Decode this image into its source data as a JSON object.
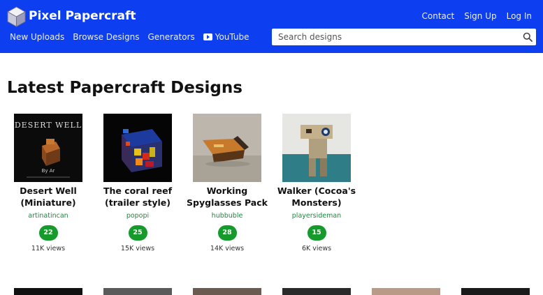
{
  "header": {
    "brand": "Pixel Papercraft",
    "auth_links": [
      "Contact",
      "Sign Up",
      "Log In"
    ],
    "nav": [
      "New Uploads",
      "Browse Designs",
      "Generators"
    ],
    "youtube_label": "YouTube",
    "search_placeholder": "Search designs",
    "bg_color": "#0d3ff0"
  },
  "main": {
    "title": "Latest Papercraft Designs",
    "cards": [
      {
        "title": "Desert Well (Miniature)",
        "author": "artinatincan",
        "likes": "22",
        "views": "11K views",
        "thumb_caption": "DESERT WELL",
        "thumb_byline": "By Ar"
      },
      {
        "title": "The coral reef (trailer style)",
        "author": "popopi",
        "likes": "25",
        "views": "15K views"
      },
      {
        "title": "Working Spyglasses Pack",
        "author": "hubbuble",
        "likes": "28",
        "views": "14K views"
      },
      {
        "title": "Walker (Cocoa's Monsters)",
        "author": "playersideman",
        "likes": "15",
        "views": "6K views"
      }
    ]
  },
  "colors": {
    "accent": "#0d3ff0",
    "like_badge": "#179a2c",
    "author_link": "#178a3a"
  }
}
